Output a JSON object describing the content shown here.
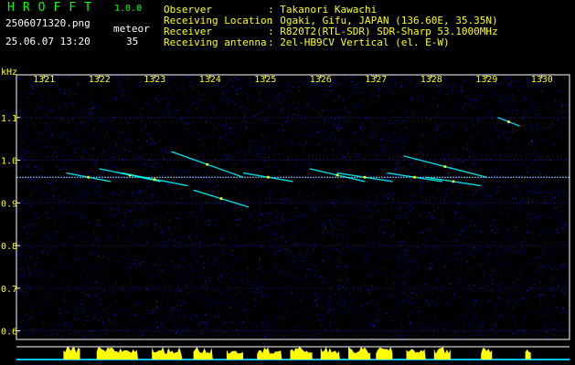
{
  "app": {
    "name": "HROFFT",
    "version": "1.0.0"
  },
  "file": {
    "name": "2506071320.png",
    "datetime": "25.06.07 13:20"
  },
  "mode": {
    "label": "meteor",
    "count": "35"
  },
  "info": {
    "observer_label": "Observer",
    "observer_value": ": Takanori Kawachi",
    "location_label": "Receiving Location",
    "location_value": ": Ogaki, Gifu, JAPAN (136.60E, 35.35N)",
    "receiver_label": "Receiver",
    "receiver_value": ": R820T2(RTL-SDR) SDR-Sharp 53.1000MHz",
    "antenna_label": "Receiving antenna",
    "antenna_value": ": 2el-HB9CV Vertical (el. E-W)"
  },
  "chart_data": {
    "type": "heatmap",
    "title": "",
    "xlabel": "",
    "ylabel": "kHz",
    "x_ticks": [
      "1321",
      "1322",
      "1323",
      "1324",
      "1325",
      "1326",
      "1327",
      "1328",
      "1329",
      "1330"
    ],
    "y_ticks": [
      "1.1",
      "1.0",
      "0.9",
      "0.8",
      "0.7",
      "0.6"
    ],
    "x_range": [
      1320.5,
      1330.5
    ],
    "y_range": [
      0.58,
      1.2
    ],
    "carrier_khz": 0.96,
    "meteor_traces": [
      {
        "x": [
          1321.4,
          1322.2
        ],
        "y": [
          0.97,
          0.95
        ]
      },
      {
        "x": [
          1322.0,
          1323.1
        ],
        "y": [
          0.98,
          0.95
        ]
      },
      {
        "x": [
          1322.4,
          1323.6
        ],
        "y": [
          0.97,
          0.94
        ]
      },
      {
        "x": [
          1323.3,
          1324.6
        ],
        "y": [
          1.02,
          0.96
        ]
      },
      {
        "x": [
          1323.7,
          1324.7
        ],
        "y": [
          0.93,
          0.89
        ]
      },
      {
        "x": [
          1324.6,
          1325.5
        ],
        "y": [
          0.97,
          0.95
        ]
      },
      {
        "x": [
          1325.8,
          1326.8
        ],
        "y": [
          0.98,
          0.95
        ]
      },
      {
        "x": [
          1326.3,
          1327.3
        ],
        "y": [
          0.97,
          0.95
        ]
      },
      {
        "x": [
          1327.2,
          1328.2
        ],
        "y": [
          0.97,
          0.95
        ]
      },
      {
        "x": [
          1327.9,
          1328.9
        ],
        "y": [
          0.96,
          0.94
        ]
      },
      {
        "x": [
          1327.5,
          1329.0
        ],
        "y": [
          1.01,
          0.96
        ]
      },
      {
        "x": [
          1329.2,
          1329.6
        ],
        "y": [
          1.1,
          1.08
        ]
      }
    ],
    "activity_bursts": [
      {
        "from": 1321.35,
        "to": 1321.65
      },
      {
        "from": 1321.95,
        "to": 1322.7
      },
      {
        "from": 1322.95,
        "to": 1323.5
      },
      {
        "from": 1323.7,
        "to": 1324.05
      },
      {
        "from": 1324.3,
        "to": 1324.6
      },
      {
        "from": 1324.85,
        "to": 1325.3
      },
      {
        "from": 1325.45,
        "to": 1325.85
      },
      {
        "from": 1326.0,
        "to": 1326.35
      },
      {
        "from": 1326.5,
        "to": 1326.9
      },
      {
        "from": 1327.0,
        "to": 1327.3
      },
      {
        "from": 1327.55,
        "to": 1327.9
      },
      {
        "from": 1328.05,
        "to": 1328.35
      },
      {
        "from": 1328.9,
        "to": 1329.1
      },
      {
        "from": 1329.7,
        "to": 1329.8
      }
    ],
    "colors": {
      "background": "#000000",
      "noise": "#0000a0",
      "frame": "#ffffff",
      "tick_label": "#ffff00",
      "meteor": "#00ffff",
      "meteor_peak": "#ffff00",
      "activity_bars": "#ffff00",
      "baseline": "#00c0ff"
    }
  }
}
